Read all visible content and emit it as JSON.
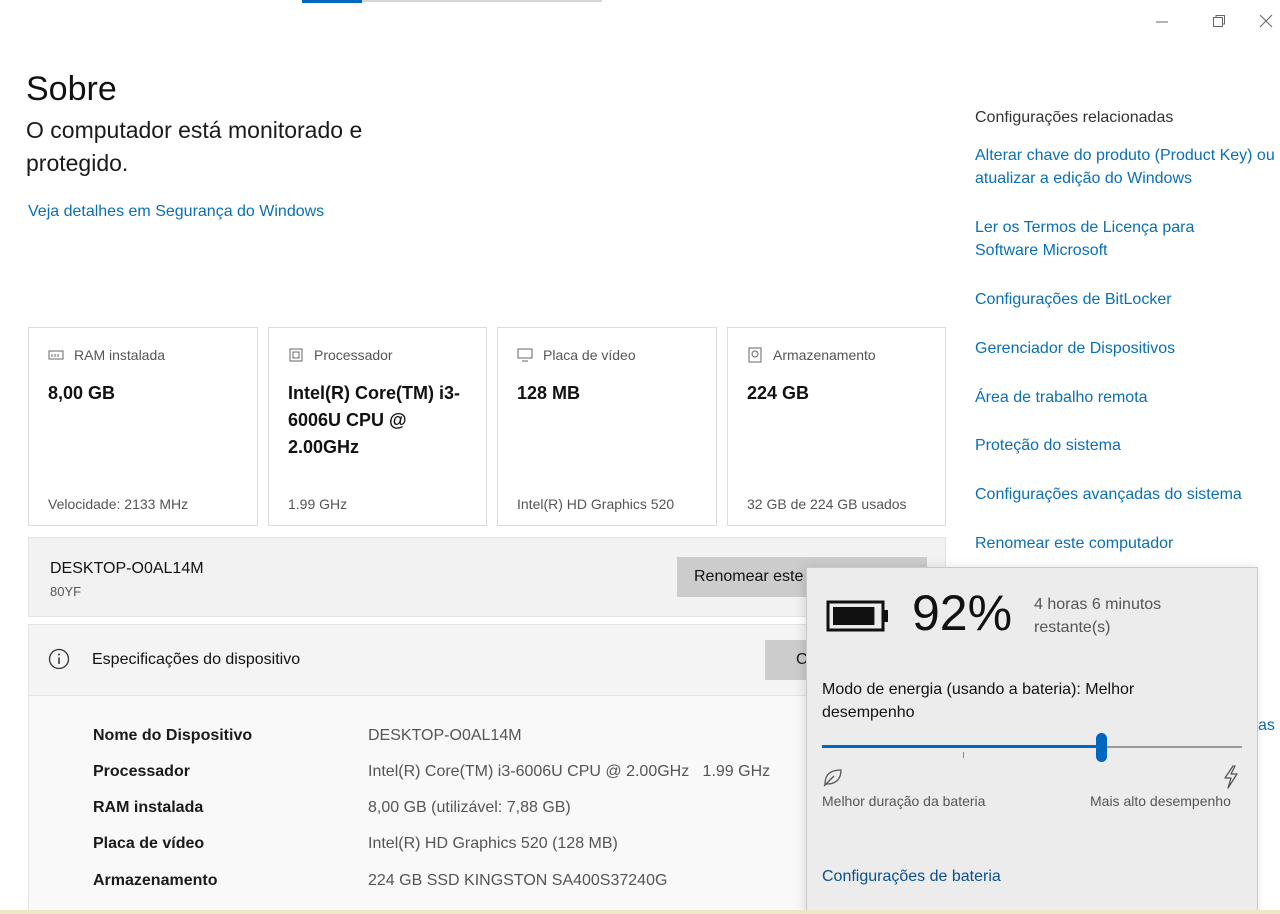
{
  "window": {
    "minimize_icon": "minimize-icon",
    "restore_icon": "restore-icon",
    "close_icon": "close-icon"
  },
  "page": {
    "title": "Sobre",
    "protection_text": "O computador está monitorado e protegido.",
    "security_link": "Veja detalhes em Segurança do Windows"
  },
  "cards": [
    {
      "label": "RAM instalada",
      "icon": "ram-icon",
      "value": "8,00 GB",
      "footer": "Velocidade: 2133 MHz"
    },
    {
      "label": "Processador",
      "icon": "processor-icon",
      "value": "Intel(R) Core(TM) i3-6006U CPU @ 2.00GHz",
      "footer": "1.99 GHz"
    },
    {
      "label": "Placa de vídeo",
      "icon": "monitor-icon",
      "value": "128 MB",
      "footer": "Intel(R) HD Graphics 520"
    },
    {
      "label": "Armazenamento",
      "icon": "storage-icon",
      "value": "224 GB",
      "footer": "32 GB de 224 GB usados"
    }
  ],
  "device": {
    "name": "DESKTOP-O0AL14M",
    "model": "80YF",
    "rename_button": "Renomear este computador"
  },
  "specs": {
    "title": "Especificações do dispositivo",
    "copy_button": "Copiar",
    "rows": [
      {
        "label": "Nome do Dispositivo",
        "value": "DESKTOP-O0AL14M"
      },
      {
        "label": "Processador",
        "value": "Intel(R) Core(TM) i3-6006U CPU @ 2.00GHz   1.99 GHz"
      },
      {
        "label": "RAM instalada",
        "value": "8,00 GB (utilizável: 7,88 GB)"
      },
      {
        "label": "Placa de vídeo",
        "value": "Intel(R) HD Graphics 520 (128 MB)"
      },
      {
        "label": "Armazenamento",
        "value": "224 GB SSD KINGSTON SA400S37240G"
      }
    ]
  },
  "related": {
    "title": "Configurações relacionadas",
    "links": [
      "Alterar chave do produto (Product Key) ou atualizar a edição do Windows",
      "Ler os Termos de Licença para Software Microsoft",
      "Configurações de BitLocker",
      "Gerenciador de Dispositivos",
      "Área de trabalho remota",
      "Proteção do sistema",
      "Configurações avançadas do sistema",
      "Renomear este computador"
    ],
    "partial_link": "as"
  },
  "battery": {
    "percent": "92%",
    "percent_value": 92,
    "time_remaining": "4 horas 6 minutos restante(s)",
    "mode_text": "Modo de energia (usando a bateria): Melhor desempenho",
    "slider_position": 0.665,
    "slider_left_label": "Melhor duração da bateria",
    "slider_right_label": "Mais alto desempenho",
    "settings_link": "Configurações de bateria"
  },
  "colors": {
    "accent": "#0067c0",
    "link": "#0a6fb7"
  }
}
